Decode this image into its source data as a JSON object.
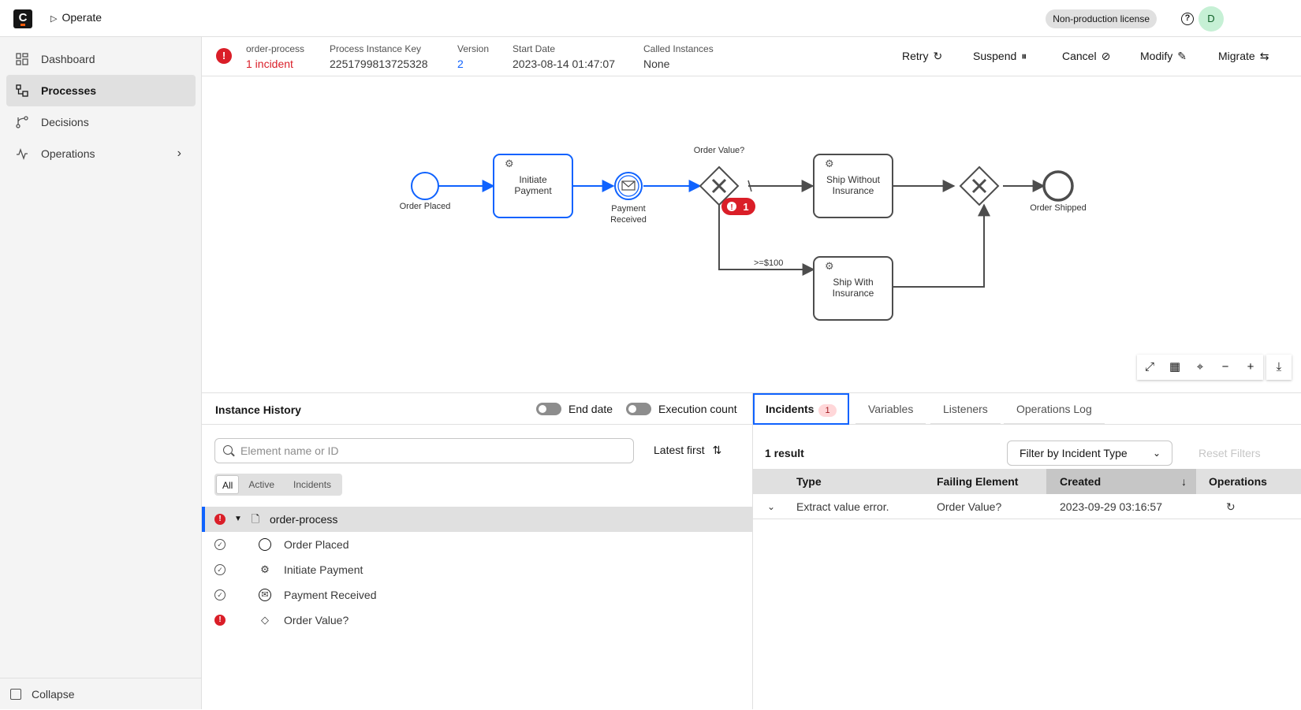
{
  "topbar": {
    "logo": "C",
    "app_name": "Operate",
    "license": "Non-production license",
    "help_glyph": "?",
    "avatar_initial": "D"
  },
  "sidebar": {
    "items": [
      {
        "label": "Dashboard",
        "icon": "dashboard-icon",
        "active": false
      },
      {
        "label": "Processes",
        "icon": "processes-icon",
        "active": true
      },
      {
        "label": "Decisions",
        "icon": "decisions-icon",
        "active": false
      },
      {
        "label": "Operations",
        "icon": "operations-icon",
        "active": false
      }
    ],
    "collapse_label": "Collapse"
  },
  "header": {
    "process_name": "order-process",
    "incident_text": "1 incident",
    "key_label": "Process Instance Key",
    "key_value": "2251799813725328",
    "version_label": "Version",
    "version_value": "2",
    "start_label": "Start Date",
    "start_value": "2023-08-14 01:47:07",
    "called_label": "Called Instances",
    "called_value": "None",
    "actions": {
      "retry": "Retry",
      "suspend": "Suspend",
      "cancel": "Cancel",
      "modify": "Modify",
      "migrate": "Migrate"
    }
  },
  "diagram": {
    "start_event": "Order Placed",
    "task_payment": [
      "Initiate",
      "Payment"
    ],
    "message_event": [
      "Payment",
      "Received"
    ],
    "gateway_label": "Order Value?",
    "incident_count": "1",
    "task_no_ins": [
      "Ship Without",
      "Insurance"
    ],
    "task_ins": [
      "Ship With",
      "Insurance"
    ],
    "condition": ">=$100",
    "end_event": "Order Shipped"
  },
  "history": {
    "title": "Instance History",
    "end_date": "End date",
    "execution_count": "Execution count",
    "search_placeholder": "Element name or ID",
    "sort_label": "Latest first",
    "filters": [
      "All",
      "Active",
      "Incidents"
    ],
    "rows": [
      {
        "label": "order-process",
        "status": "error",
        "icon": "document-icon"
      },
      {
        "label": "Order Placed",
        "status": "completed",
        "icon": "start-event-icon"
      },
      {
        "label": "Initiate Payment",
        "status": "completed",
        "icon": "service-task-icon"
      },
      {
        "label": "Payment Received",
        "status": "completed",
        "icon": "message-event-icon"
      },
      {
        "label": "Order Value?",
        "status": "error",
        "icon": "gateway-icon"
      }
    ]
  },
  "incidents": {
    "tabs": [
      "Incidents",
      "Variables",
      "Listeners",
      "Operations Log"
    ],
    "incident_badge": "1",
    "result_count": "1 result",
    "filter_label": "Filter by Incident Type",
    "reset_label": "Reset Filters",
    "columns": [
      "Type",
      "Failing Element",
      "Created",
      "Operations"
    ],
    "rows": [
      {
        "type": "Extract value error.",
        "element": "Order Value?",
        "created": "2023-09-29 03:16:57"
      }
    ]
  },
  "colors": {
    "accent": "#0f62fe",
    "error": "#da1e28",
    "active_path": "#0f62fe"
  }
}
